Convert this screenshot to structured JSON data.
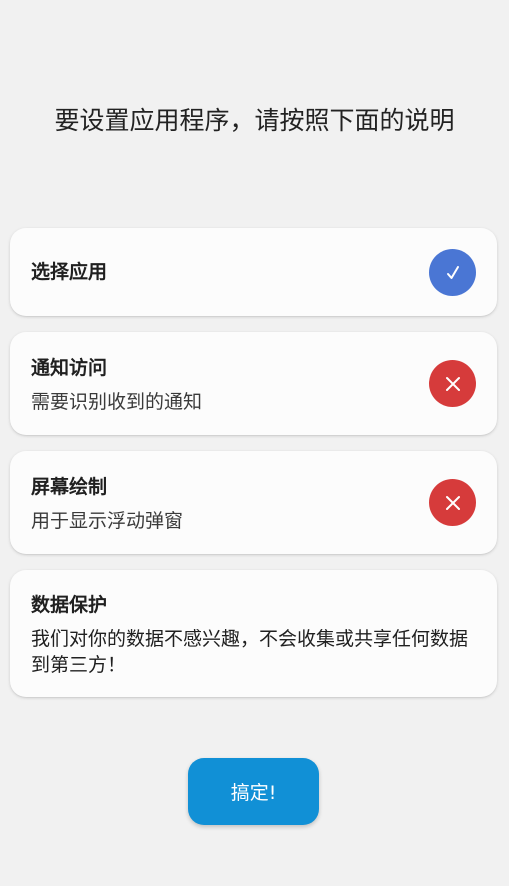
{
  "header": {
    "title": "要设置应用程序，请按照下面的说明"
  },
  "steps": [
    {
      "title": "选择应用",
      "description": "",
      "status": "done",
      "status_icon": "checkmark-icon",
      "status_color": "#4a76d4"
    },
    {
      "title": "通知访问",
      "description": "需要识别收到的通知",
      "status": "missing",
      "status_icon": "close-icon",
      "status_color": "#d63b3b"
    },
    {
      "title": "屏幕绘制",
      "description": "用于显示浮动弹窗",
      "status": "missing",
      "status_icon": "close-icon",
      "status_color": "#d63b3b"
    }
  ],
  "privacy": {
    "title": "数据保护",
    "description": "我们对你的数据不感兴趣，不会收集或共享任何数据到第三方！"
  },
  "done_button": {
    "label": "搞定!",
    "color": "#1190d6"
  }
}
